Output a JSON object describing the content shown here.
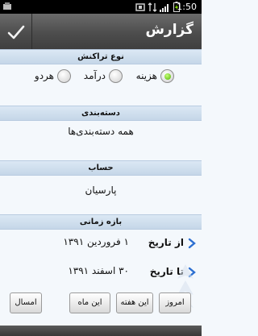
{
  "status_bar": {
    "time": "1:50",
    "icons": [
      "usb-debug-icon",
      "data-3g-icon",
      "signal-icon",
      "battery-icon"
    ]
  },
  "title_bar": {
    "title": "گزارش",
    "confirm_icon": "checkmark-icon"
  },
  "transaction_type": {
    "header": "نوع تراکنش",
    "options": [
      {
        "label": "هزینه",
        "selected": true
      },
      {
        "label": "درآمد",
        "selected": false
      },
      {
        "label": "هردو",
        "selected": false
      }
    ]
  },
  "category": {
    "header": "دسته‌بندی",
    "value": "همه دسته‌بندی‌ها"
  },
  "account": {
    "header": "حساب",
    "value": "پارسیان"
  },
  "period": {
    "header": "بازه زمانی",
    "from_label": "از تاریخ",
    "from_value": "۱ فروردین ۱۳۹۱",
    "to_label": "تا تاریخ",
    "to_value": "۳۰ اسفند ۱۳۹۱"
  },
  "quick_buttons": {
    "today": "امروز",
    "this_week": "این هفته",
    "this_month": "این ماه",
    "this_year": "امسال"
  },
  "colors": {
    "header_bg": "#c9dbec",
    "selected_radio": "#5fc400",
    "chevron": "#2c6fd1"
  }
}
